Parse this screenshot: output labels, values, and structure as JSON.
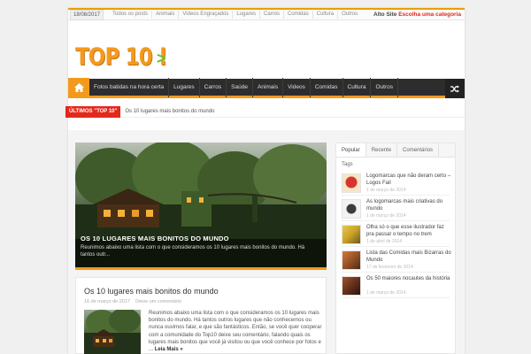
{
  "topbar": {
    "date": "18/08/2017",
    "links": [
      "Todos os posts",
      "Animais",
      "Videos Engraçados",
      "Lugares",
      "Carros",
      "Comidas",
      "Cultura",
      "Outros"
    ],
    "site_label": "Alto Site",
    "category_label": "Escolha uma categoria"
  },
  "logo": {
    "text": "TOP 10 !",
    "arrow": ">"
  },
  "nav": {
    "items": [
      "Fotos batidas na hora certa",
      "Lugares",
      "Carros",
      "Saúde",
      "Animais",
      "Videos",
      "Comidas",
      "Cultura",
      "Outros"
    ]
  },
  "breaking": {
    "label": "ÚLTIMOS \"TOP 10\"",
    "text": "Os 10 lugares mais bonitos do mundo"
  },
  "slider": {
    "title": "OS 10 LUGARES MAIS BONITOS DO MUNDO",
    "desc": "Reunimos abaixo uma lista com o que consideramos os 10 lugares mais bonitos do mundo. Há tantos outr..."
  },
  "post": {
    "title": "Os 10 lugares mais bonitos do mundo",
    "date": "16 de março de 2017",
    "comments": "Deixe um comentário",
    "excerpt": "Reunimos abaixo uma lista com o que consideramos os 10 lugares mais bonitos do mundo. Há tantos outros lugares que não conhecemos ou nunca ouvimos falar, e que são fantásticos. Então, se você quer cooperar com a comunidade do Top10 deixe seu comentário, falando quais os lugares mais bonitos que você já visitou ou que você conhece por fotos e ...",
    "read_more": "Leia Mais »"
  },
  "sidebar": {
    "tabs": [
      "Popular",
      "Recente",
      "Comentários"
    ],
    "tags_label": "Tags",
    "items": [
      {
        "title": "Logomarcas que não deram certo – Logos Fail",
        "date": "1 de março de 2014",
        "color": "#d9342b"
      },
      {
        "title": "As logomarcas mais criativas do mundo",
        "date": "1 de março de 2014",
        "color": "#3b3b3b"
      },
      {
        "title": "Olha só o que esse ilustrador faz pra passar o tempo no trem",
        "date": "1 de abril de 2014",
        "color": "#c9a227"
      },
      {
        "title": "Lista das Comidas mais Bizarras do Mundo",
        "date": "17 de fevereiro de 2014",
        "color": "#8a4a24"
      },
      {
        "title": "Os 50 maiores nocautes da história",
        "date": "1 de março de 2014",
        "color": "#5a2a1a"
      }
    ]
  },
  "colors": {
    "accent": "#f39a1d",
    "breaking": "#e3291b",
    "nav": "#2d2d2d",
    "logo_arrow": "#69c12b"
  }
}
